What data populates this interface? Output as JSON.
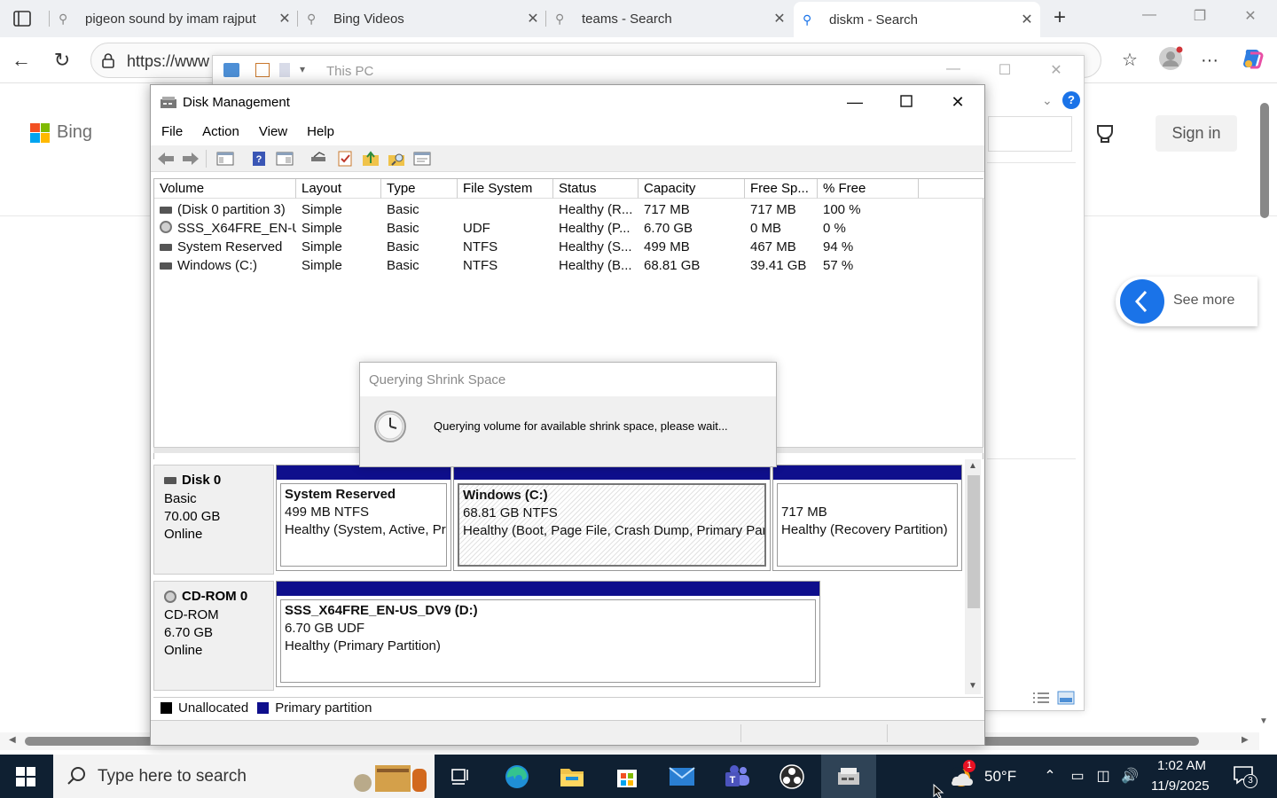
{
  "browser": {
    "tabs": [
      {
        "title": "pigeon sound by imam rajput"
      },
      {
        "title": "Bing Videos"
      },
      {
        "title": "teams - Search"
      },
      {
        "title": "diskm - Search"
      }
    ],
    "url": "https://www"
  },
  "bing": {
    "logo": "Bing",
    "sign_in": "Sign in",
    "see_more": "See more"
  },
  "explorer": {
    "title": "This PC"
  },
  "disk_mgmt": {
    "title": "Disk Management",
    "menu": [
      "File",
      "Action",
      "View",
      "Help"
    ],
    "columns": [
      "Volume",
      "Layout",
      "Type",
      "File System",
      "Status",
      "Capacity",
      "Free Sp...",
      "% Free"
    ],
    "volumes": [
      {
        "volume": "(Disk 0 partition 3)",
        "layout": "Simple",
        "type": "Basic",
        "fs": "",
        "status": "Healthy (R...",
        "capacity": "717 MB",
        "free": "717 MB",
        "pct": "100 %",
        "icon": "drive-icon"
      },
      {
        "volume": "SSS_X64FRE_EN-U...",
        "layout": "Simple",
        "type": "Basic",
        "fs": "UDF",
        "status": "Healthy (P...",
        "capacity": "6.70 GB",
        "free": "0 MB",
        "pct": "0 %",
        "icon": "cdrom-icon"
      },
      {
        "volume": "System Reserved",
        "layout": "Simple",
        "type": "Basic",
        "fs": "NTFS",
        "status": "Healthy (S...",
        "capacity": "499 MB",
        "free": "467 MB",
        "pct": "94 %",
        "icon": "drive-icon"
      },
      {
        "volume": "Windows (C:)",
        "layout": "Simple",
        "type": "Basic",
        "fs": "NTFS",
        "status": "Healthy (B...",
        "capacity": "68.81 GB",
        "free": "39.41 GB",
        "pct": "57 %",
        "icon": "drive-icon"
      }
    ],
    "disks": [
      {
        "name": "Disk 0",
        "kind": "Basic",
        "size": "70.00 GB",
        "state": "Online",
        "partitions": [
          {
            "name": "System Reserved",
            "detail": "499 MB NTFS",
            "status": "Healthy (System, Active, Pri"
          },
          {
            "name": "Windows  (C:)",
            "detail": "68.81 GB NTFS",
            "status": "Healthy (Boot, Page File, Crash Dump, Primary Parti"
          },
          {
            "name": "",
            "detail": "717 MB",
            "status": "Healthy (Recovery Partition)"
          }
        ]
      },
      {
        "name": "CD-ROM 0",
        "kind": "CD-ROM",
        "size": "6.70 GB",
        "state": "Online",
        "partitions": [
          {
            "name": "SSS_X64FRE_EN-US_DV9  (D:)",
            "detail": "6.70 GB UDF",
            "status": "Healthy (Primary Partition)"
          }
        ]
      }
    ],
    "legend": {
      "unallocated": "Unallocated",
      "primary": "Primary partition"
    },
    "colors": {
      "primary_partition": "#0f0f8c",
      "unallocated": "#000000"
    }
  },
  "dialog": {
    "title": "Querying Shrink Space",
    "message": "Querying volume for available shrink space, please wait..."
  },
  "taskbar": {
    "search_placeholder": "Type here to search",
    "weather_temp": "50°F",
    "weather_badge": "1",
    "time": "1:02 AM",
    "date": "11/9/2025",
    "notifications": "3"
  }
}
